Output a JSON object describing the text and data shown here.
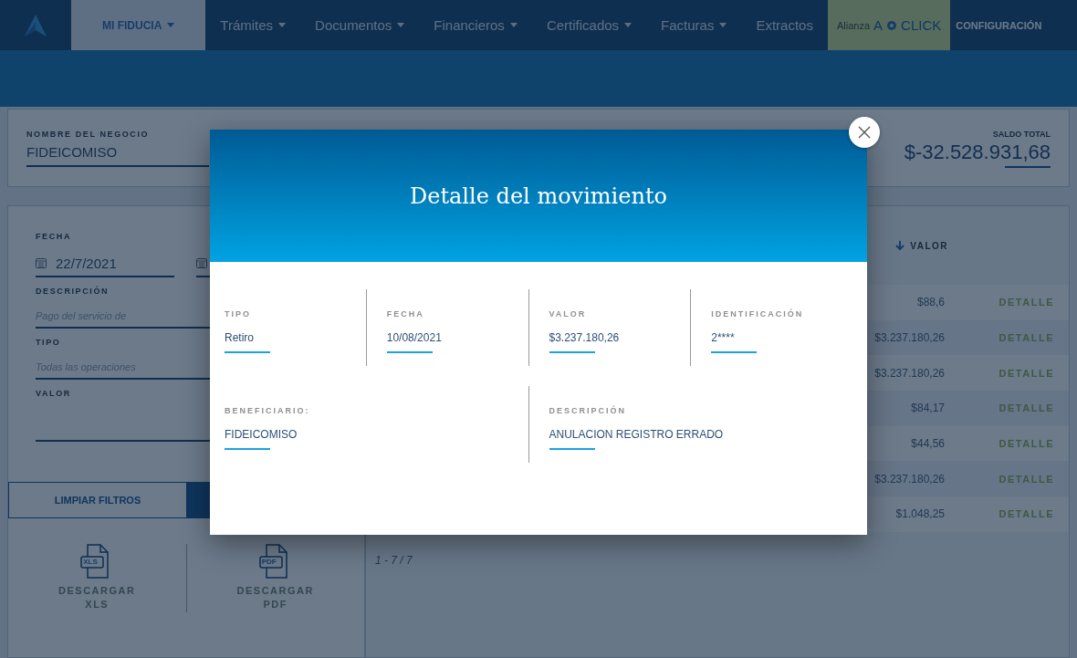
{
  "nav": {
    "items": [
      {
        "label": "MI FIDUCIA",
        "dropdown": true,
        "selected": true
      },
      {
        "label": "Trámites",
        "dropdown": true,
        "selected": false
      },
      {
        "label": "Documentos",
        "dropdown": true,
        "selected": false
      },
      {
        "label": "Financieros",
        "dropdown": true,
        "selected": false
      },
      {
        "label": "Certificados",
        "dropdown": true,
        "selected": false
      },
      {
        "label": "Facturas",
        "dropdown": true,
        "selected": false
      },
      {
        "label": "Extractos",
        "dropdown": false,
        "selected": false
      }
    ],
    "alliance": {
      "prefix": "Alianza",
      "brand_start": "A",
      "brand_end": "CLICK"
    },
    "settings": "CONFIGURACIÓN"
  },
  "business": {
    "label": "NOMBRE DEL NEGOCIO",
    "value": "FIDEICOMISO"
  },
  "balance": {
    "label": "SALDO TOTAL",
    "value": "$-32.528.931,68"
  },
  "filters": {
    "date_label": "FECHA",
    "date_from": "22/7/2021",
    "description_label": "DESCRIPCIÓN",
    "description_placeholder": "Pago del servicio de",
    "type_label": "TIPO",
    "type_placeholder": "Todas las operaciones",
    "value_label": "VALOR",
    "clear_button": "LIMPIAR FILTROS"
  },
  "downloads": [
    {
      "badge": "XLS",
      "label": "DESCARGAR XLS"
    },
    {
      "badge": "PDF",
      "label": "DESCARGAR PDF"
    }
  ],
  "table": {
    "value_header": "VALOR",
    "rows": [
      {
        "value": "$88,6",
        "action": "DETALLE"
      },
      {
        "value": "$3.237.180,26",
        "action": "DETALLE"
      },
      {
        "value": "$3.237.180,26",
        "action": "DETALLE"
      },
      {
        "value": "$84,17",
        "action": "DETALLE"
      },
      {
        "value": "$44,56",
        "action": "DETALLE"
      },
      {
        "value": "$3.237.180,26",
        "action": "DETALLE"
      },
      {
        "value": "$1.048,25",
        "action": "DETALLE"
      }
    ],
    "pagination": "1 - 7 / 7"
  },
  "modal": {
    "title": "Detalle del movimiento",
    "summary_fields": [
      {
        "label": "TIPO",
        "value": "Retiro"
      },
      {
        "label": "FECHA",
        "value": "10/08/2021"
      },
      {
        "label": "VALOR",
        "value": "$3.237.180,26"
      },
      {
        "label": "IDENTIFICACIÓN",
        "value": "2****"
      }
    ],
    "detail_fields": [
      {
        "label": "BENEFICIARIO:",
        "value": "FIDEICOMISO"
      },
      {
        "label": "DESCRIPCIÓN",
        "value": "ANULACION REGISTRO ERRADO"
      }
    ]
  }
}
